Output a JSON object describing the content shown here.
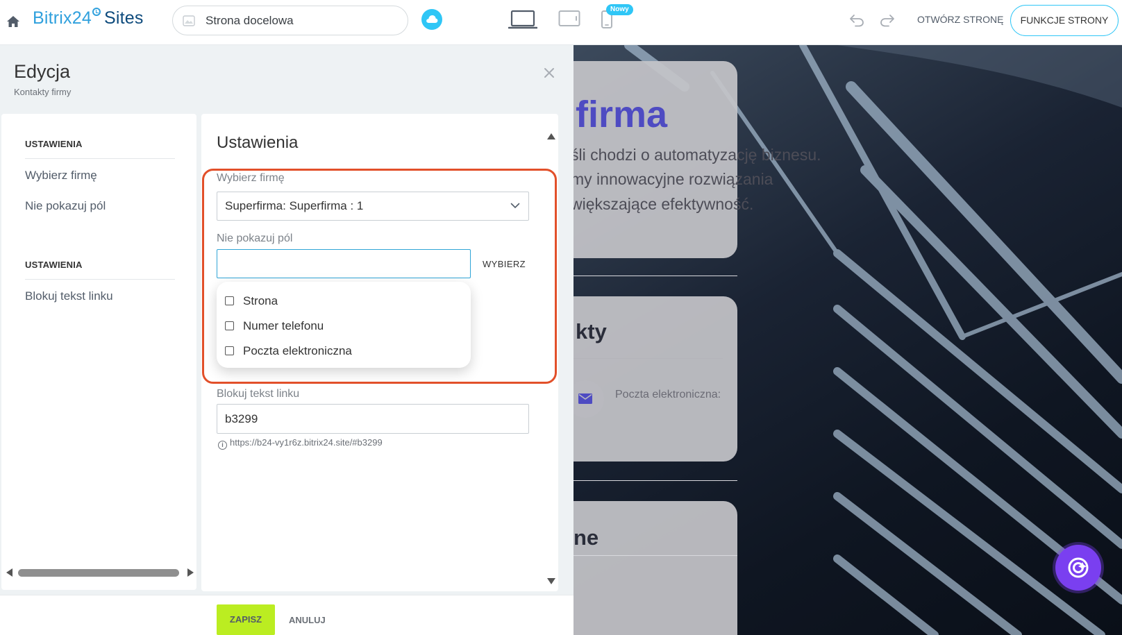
{
  "header": {
    "logo_brand": "Bitrix24",
    "logo_product": "Sites",
    "page_selector": "Strona docelowa",
    "new_badge": "Nowy",
    "open_page": "OTWÓRZ STRONĘ",
    "page_features": "FUNKCJE STRONY"
  },
  "editor": {
    "title": "Edycja",
    "subtitle": "Kontakty firmy",
    "nav": {
      "sections": [
        {
          "heading": "USTAWIENIA",
          "items": [
            "Wybierz firmę",
            "Nie pokazuj pól"
          ]
        },
        {
          "heading": "USTAWIENIA",
          "items": [
            "Blokuj tekst linku"
          ]
        }
      ]
    },
    "form": {
      "title": "Ustawienia",
      "company_label": "Wybierz firmę",
      "company_value": "Superfirma: Superfirma : 1",
      "hide_fields_label": "Nie pokazuj pól",
      "choose_label": "WYBIERZ",
      "options": [
        {
          "label": "Strona",
          "checked": false
        },
        {
          "label": "Numer telefonu",
          "checked": false
        },
        {
          "label": "Poczta elektroniczna",
          "checked": false
        }
      ],
      "anchor_label": "Blokuj tekst linku",
      "anchor_value": "b3299",
      "anchor_url": "https://b24-vy1r6z.bitrix24.site/#b3299"
    },
    "footer": {
      "save": "ZAPISZ",
      "cancel": "ANULUJ"
    }
  },
  "preview": {
    "heading1": "firma",
    "text_lines": [
      "śli chodzi o automatyzację biznesu.",
      "my innowacyjne rozwiązania",
      "większające efektywność."
    ],
    "heading2": "kty",
    "email_label": "Poczta elektroniczna:",
    "heading3": "ne"
  },
  "colors": {
    "accent": "#2fc6f6",
    "brand_blue": "#2fa0dd",
    "save_green": "#bbed21",
    "highlight": "#e2502a",
    "ai_purple": "#7a3ff0"
  }
}
